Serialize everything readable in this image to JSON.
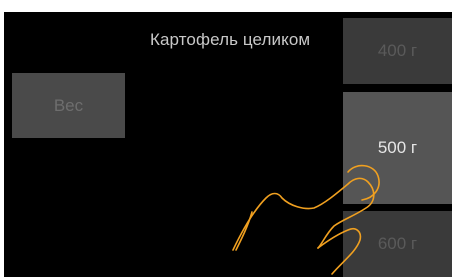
{
  "header": {
    "title": "Картофель целиком"
  },
  "weight_button": {
    "label": "Вес"
  },
  "weight_options": [
    {
      "label": "400 г",
      "state": "inactive"
    },
    {
      "label": "500 г",
      "state": "selected"
    },
    {
      "label": "600 г",
      "state": "inactive"
    }
  ],
  "gesture": {
    "icon": "tap-hand-icon",
    "color": "#f0a020"
  },
  "colors": {
    "background": "#000000",
    "selected_option": "#555555",
    "inactive_option": "#3a3a3a",
    "hand_outline": "#f0a020"
  }
}
